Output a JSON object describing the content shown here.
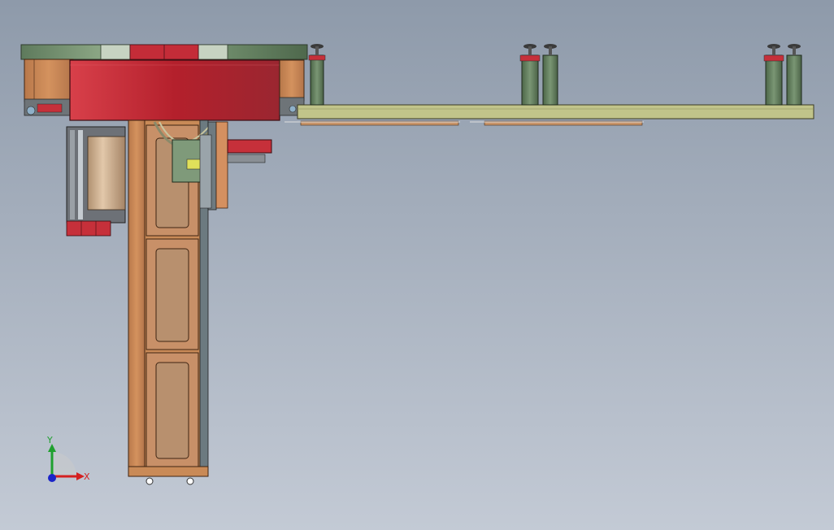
{
  "triad": {
    "x_label": "X",
    "y_label": "Y",
    "x_color": "#d42020",
    "y_color": "#1fa02f",
    "z_color": "#1a24c8"
  },
  "colors": {
    "background_top": "#8e9aaa",
    "background_bottom": "#c3cad5",
    "red_housing": "#c6303a",
    "wood": "#c98a57",
    "door_panel": "#b89476",
    "rail_olive": "#c1c48a",
    "post_green": "#5f7a5a",
    "ring_green": "#7d9a78"
  }
}
